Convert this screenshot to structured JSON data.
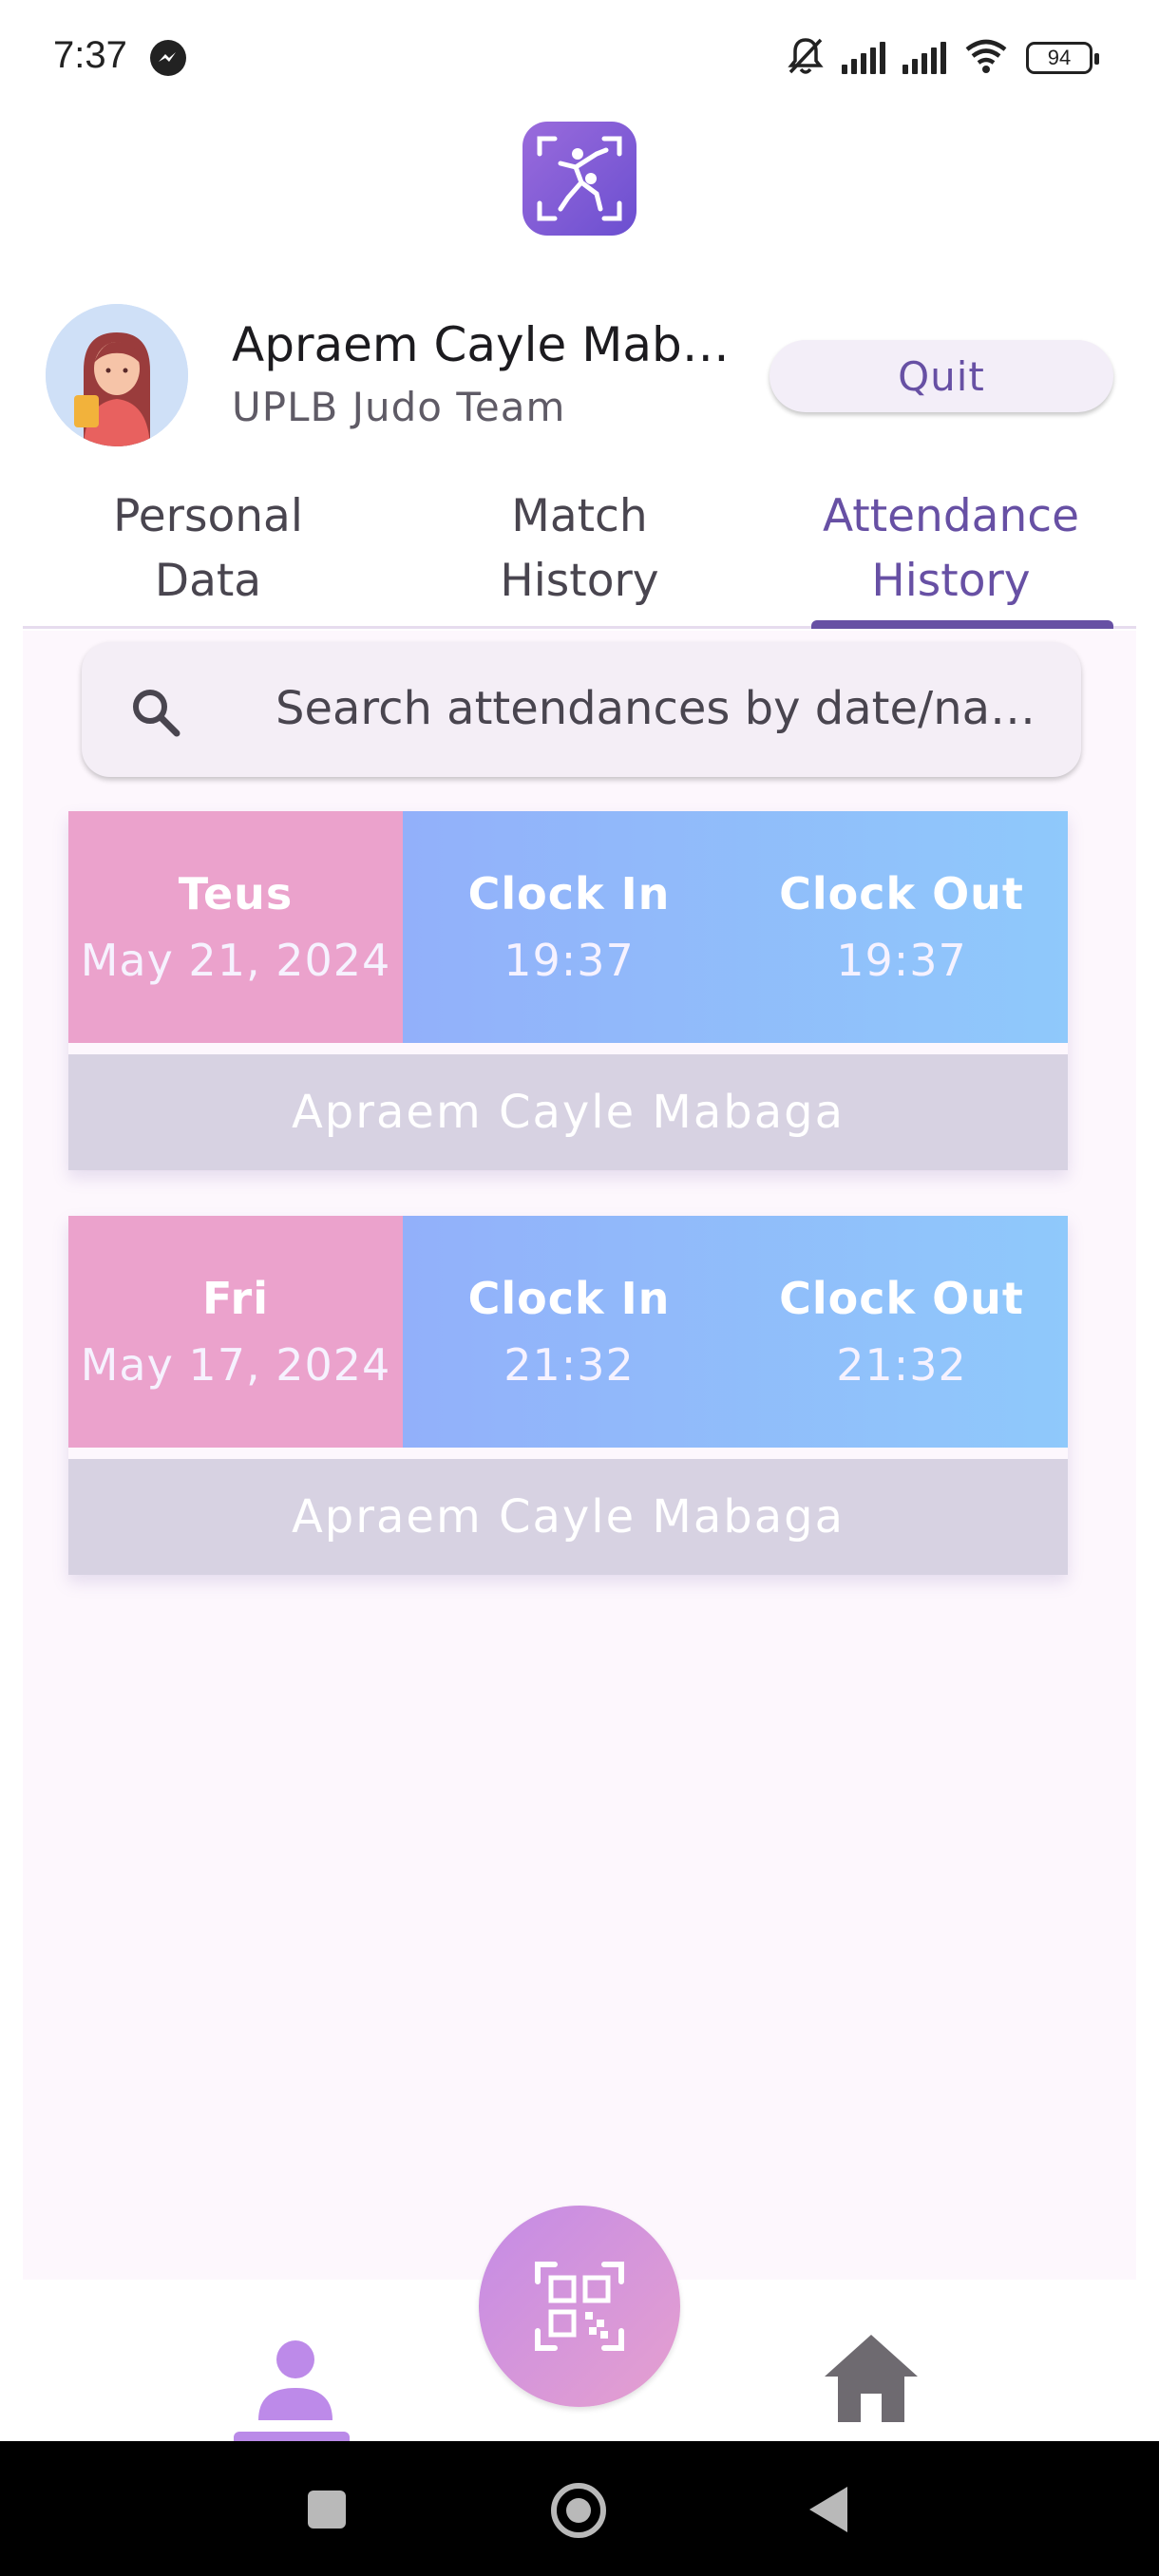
{
  "status_bar": {
    "time": "7:37",
    "battery": "94",
    "icons": [
      "messenger-icon",
      "mute-icon",
      "signal-icon",
      "signal-icon",
      "wifi-icon",
      "battery-icon"
    ]
  },
  "header": {
    "logo_icon": "judo-app-logo",
    "user_name": "Apraem Cayle Maba...",
    "team": "UPLB Judo Team",
    "quit_label": "Quit"
  },
  "tabs": [
    {
      "line1": "Personal",
      "line2": "Data"
    },
    {
      "line1": "Match",
      "line2": "History"
    },
    {
      "line1": "Attendance",
      "line2": "History"
    }
  ],
  "active_tab": "Attendance History",
  "search": {
    "placeholder": "Search attendances by date/name..."
  },
  "attendance": [
    {
      "day": "Teus",
      "date": "May 21, 2024",
      "clock_in_label": "Clock In",
      "clock_in": "19:37",
      "clock_out_label": "Clock Out",
      "clock_out": "19:37",
      "name": "Apraem Cayle Mabaga"
    },
    {
      "day": "Fri",
      "date": "May 17, 2024",
      "clock_in_label": "Clock In",
      "clock_in": "21:32",
      "clock_out_label": "Clock Out",
      "clock_out": "21:32",
      "name": "Apraem Cayle Mabaga"
    }
  ],
  "bottom_nav": {
    "items": [
      "profile-icon",
      "qr-code-icon",
      "home-icon"
    ],
    "active": "profile-icon"
  },
  "colors": {
    "accent": "#6750a4",
    "day_cell": "#eba2cc",
    "clock_gradient_start": "#92b0fa",
    "clock_gradient_end": "#8fc9fb",
    "name_bar": "#d7d2e2",
    "fab_start": "#c48be6",
    "fab_end": "#e6a0cf"
  }
}
